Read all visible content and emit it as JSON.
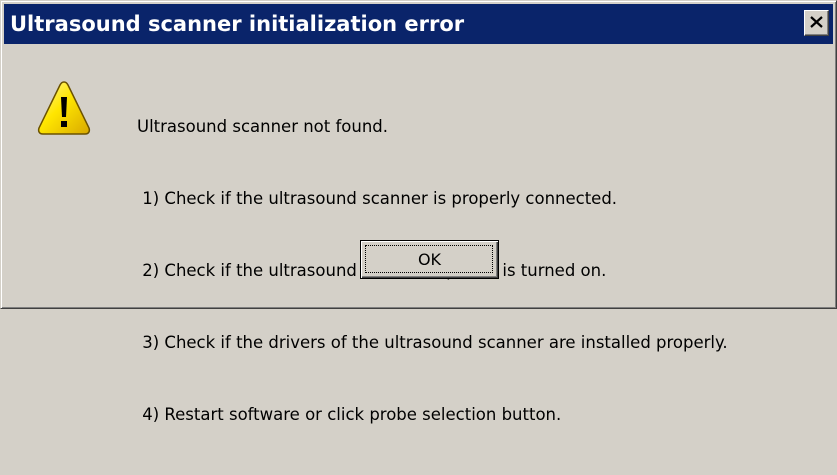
{
  "window": {
    "title": "Ultrasound scanner initialization error",
    "titlebar_color": "#0a246a",
    "background_color": "#d4d0c8"
  },
  "icon": "warning-triangle-icon",
  "message": {
    "lines": [
      "Ultrasound scanner not found.",
      " 1) Check if the ultrasound scanner is properly connected.",
      " 2) Check if the ultrasound scanner's power is turned on.",
      " 3) Check if the drivers of the ultrasound scanner are installed properly.",
      " 4) Restart software or click probe selection button."
    ]
  },
  "buttons": {
    "ok_label": "OK",
    "close_icon": "close-icon"
  }
}
